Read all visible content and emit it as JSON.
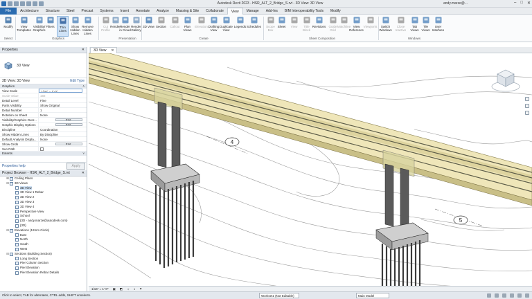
{
  "window": {
    "title": "Autodesk Revit 2023 - HSR_ALT_2_Bridge_S.rvt - 3D View: 3D View",
    "user": "andy.marze@..."
  },
  "tabs": [
    "File",
    "Architecture",
    "Structure",
    "Steel",
    "Precast",
    "Systems",
    "Insert",
    "Annotate",
    "Analyze",
    "Massing & Site",
    "Collaborate",
    "View",
    "Manage",
    "Add-Ins",
    "BIM Interoperability Tools",
    "Modify"
  ],
  "ribbon": {
    "select_label": "Select",
    "buttons": [
      {
        "label": "Modify",
        "icon": "cursor-icon"
      },
      {
        "label": "View Templates",
        "icon": "view-template-icon"
      },
      {
        "label": "Visibility/ Graphics",
        "icon": "visibility-icon"
      },
      {
        "label": "Filters",
        "icon": "filter-icon"
      },
      {
        "label": "Thin Lines",
        "icon": "thin-lines-icon"
      },
      {
        "label": "Show Hidden Lines",
        "icon": "show-hidden-icon"
      },
      {
        "label": "Remove Hidden Lines",
        "icon": "remove-hidden-icon"
      },
      {
        "label": "Cut Profile",
        "icon": "cut-profile-icon"
      },
      {
        "label": "Render",
        "icon": "render-icon"
      },
      {
        "label": "Render in Cloud",
        "icon": "cloud-render-icon"
      },
      {
        "label": "Render Gallery",
        "icon": "gallery-icon"
      },
      {
        "label": "3D View",
        "icon": "3d-view-icon"
      },
      {
        "label": "Section",
        "icon": "section-icon"
      },
      {
        "label": "Callout",
        "icon": "callout-icon"
      },
      {
        "label": "Plan Views",
        "icon": "plan-views-icon"
      },
      {
        "label": "Elevation",
        "icon": "elevation-icon"
      },
      {
        "label": "Drafting View",
        "icon": "drafting-icon"
      },
      {
        "label": "Duplicate View",
        "icon": "duplicate-icon"
      },
      {
        "label": "Legends",
        "icon": "legend-icon"
      },
      {
        "label": "Schedules",
        "icon": "schedule-icon"
      },
      {
        "label": "Scope Box",
        "icon": "scope-box-icon"
      },
      {
        "label": "Sheet",
        "icon": "sheet-icon"
      },
      {
        "label": "View",
        "icon": "view-place-icon"
      },
      {
        "label": "Title Block",
        "icon": "title-block-icon"
      },
      {
        "label": "Revisions",
        "icon": "revisions-icon"
      },
      {
        "label": "Guide Grid",
        "icon": "guide-grid-icon"
      },
      {
        "label": "Matchline",
        "icon": "matchline-icon"
      },
      {
        "label": "View Reference",
        "icon": "view-reference-icon"
      },
      {
        "label": "Viewports",
        "icon": "viewports-icon"
      },
      {
        "label": "Switch Windows",
        "icon": "switch-windows-icon"
      },
      {
        "label": "Close Inactive",
        "icon": "close-inactive-icon"
      },
      {
        "label": "Tab Views",
        "icon": "tab-views-icon"
      },
      {
        "label": "Tile Views",
        "icon": "tile-views-icon"
      },
      {
        "label": "User Interface",
        "icon": "user-interface-icon"
      }
    ],
    "groups": [
      "Graphics",
      "Presentation",
      "Create",
      "Sheet Composition",
      "Windows"
    ]
  },
  "properties": {
    "header": "Properties",
    "type_name": "3D View",
    "view_selector": "3D View: 3D View",
    "edit_type": "Edit Type",
    "group": "Graphics",
    "rows": [
      {
        "k": "View Scale",
        "v": "1/16\" = 1'-0\""
      },
      {
        "k": "Scale Value",
        "v": "192"
      },
      {
        "k": "Detail Level",
        "v": "Fine"
      },
      {
        "k": "Parts Visibility",
        "v": "Show Original"
      },
      {
        "k": "Detail Number",
        "v": "1"
      },
      {
        "k": "Rotation on Sheet",
        "v": "None"
      },
      {
        "k": "Visibility/Graphics Over...",
        "v": "Edit..."
      },
      {
        "k": "Graphic Display Options",
        "v": "Edit..."
      },
      {
        "k": "Discipline",
        "v": "Coordination"
      },
      {
        "k": "Show Hidden Lines",
        "v": "By Discipline"
      },
      {
        "k": "Default Analysis Displa...",
        "v": "None"
      },
      {
        "k": "Show Grids",
        "v": "Edit..."
      },
      {
        "k": "Sun Path",
        "v": ""
      }
    ],
    "extents": "Extents",
    "help": "Properties help",
    "apply": "Apply"
  },
  "browser": {
    "header": "Project Browser - HSR_ALT_2_Bridge_S.rvt",
    "items": [
      {
        "label": "Ceiling Plans",
        "lvl": 1,
        "tw": "+"
      },
      {
        "label": "3D Views",
        "lvl": 1,
        "tw": "-"
      },
      {
        "label": "3D View",
        "lvl": 2,
        "sel": true
      },
      {
        "label": "3D View 1 Rebar",
        "lvl": 2
      },
      {
        "label": "3D View 2",
        "lvl": 2
      },
      {
        "label": "3D View 3",
        "lvl": 2
      },
      {
        "label": "3D View 4",
        "lvl": 2
      },
      {
        "label": "Perspective View",
        "lvl": 2
      },
      {
        "label": "School",
        "lvl": 2
      },
      {
        "label": "{3D - andy.marze@autodesk.com}",
        "lvl": 2
      },
      {
        "label": "{3D}",
        "lvl": 2
      },
      {
        "label": "Elevations (12mm Circle)",
        "lvl": 1,
        "tw": "-"
      },
      {
        "label": "East",
        "lvl": 2
      },
      {
        "label": "North",
        "lvl": 2
      },
      {
        "label": "South",
        "lvl": 2
      },
      {
        "label": "West",
        "lvl": 2
      },
      {
        "label": "Sections (Building Section)",
        "lvl": 1,
        "tw": "-"
      },
      {
        "label": "Long Section",
        "lvl": 2
      },
      {
        "label": "Pier Column Section",
        "lvl": 2
      },
      {
        "label": "Pier Elevation",
        "lvl": 2
      },
      {
        "label": "Pier Elevation Rebar Details",
        "lvl": 2
      }
    ]
  },
  "view_tab": "3D View",
  "grid_labels": [
    "4",
    "5"
  ],
  "view_control": {
    "scale": "1/16\" = 1'-0\""
  },
  "status": {
    "message": "Click to select, TAB for alternates, CTRL adds, SHIFT unselects.",
    "workset": "Workset1 (Not Editable)",
    "main_model": "Main Model"
  }
}
